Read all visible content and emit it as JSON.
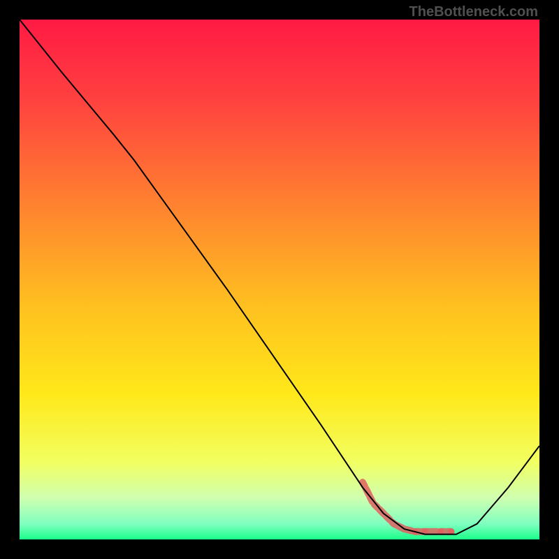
{
  "watermark": "TheBottleneck.com",
  "chart_data": {
    "type": "line",
    "title": "",
    "xlabel": "",
    "ylabel": "",
    "xlim": [
      0,
      100
    ],
    "ylim": [
      0,
      100
    ],
    "background_gradient": {
      "type": "vertical",
      "stops": [
        {
          "pos": 0.0,
          "color": "#ff1a44"
        },
        {
          "pos": 0.15,
          "color": "#ff4040"
        },
        {
          "pos": 0.35,
          "color": "#ff8030"
        },
        {
          "pos": 0.55,
          "color": "#ffc020"
        },
        {
          "pos": 0.72,
          "color": "#ffe81a"
        },
        {
          "pos": 0.85,
          "color": "#f2ff60"
        },
        {
          "pos": 0.92,
          "color": "#d0ffb0"
        },
        {
          "pos": 0.97,
          "color": "#80ffc0"
        },
        {
          "pos": 1.0,
          "color": "#1aff8a"
        }
      ]
    },
    "series": [
      {
        "name": "curve",
        "color": "#000000",
        "width": 2,
        "points": [
          {
            "x": 0,
            "y": 100
          },
          {
            "x": 8,
            "y": 90
          },
          {
            "x": 18,
            "y": 78
          },
          {
            "x": 22,
            "y": 73
          },
          {
            "x": 40,
            "y": 48
          },
          {
            "x": 58,
            "y": 22
          },
          {
            "x": 66,
            "y": 10
          },
          {
            "x": 70,
            "y": 5
          },
          {
            "x": 74,
            "y": 2
          },
          {
            "x": 78,
            "y": 1
          },
          {
            "x": 84,
            "y": 1
          },
          {
            "x": 88,
            "y": 3
          },
          {
            "x": 94,
            "y": 10
          },
          {
            "x": 100,
            "y": 18
          }
        ]
      },
      {
        "name": "highlight",
        "color": "#e06060",
        "type": "scatter",
        "points": [
          {
            "x": 66,
            "y": 11
          },
          {
            "x": 67,
            "y": 9
          },
          {
            "x": 68,
            "y": 7
          },
          {
            "x": 69,
            "y": 6
          },
          {
            "x": 70,
            "y": 5
          },
          {
            "x": 71,
            "y": 4
          },
          {
            "x": 72,
            "y": 3
          },
          {
            "x": 73,
            "y": 2.5
          },
          {
            "x": 74,
            "y": 2
          },
          {
            "x": 76,
            "y": 1.5
          },
          {
            "x": 78,
            "y": 1.5
          },
          {
            "x": 81,
            "y": 1.5
          },
          {
            "x": 83,
            "y": 1.5
          }
        ]
      }
    ]
  }
}
